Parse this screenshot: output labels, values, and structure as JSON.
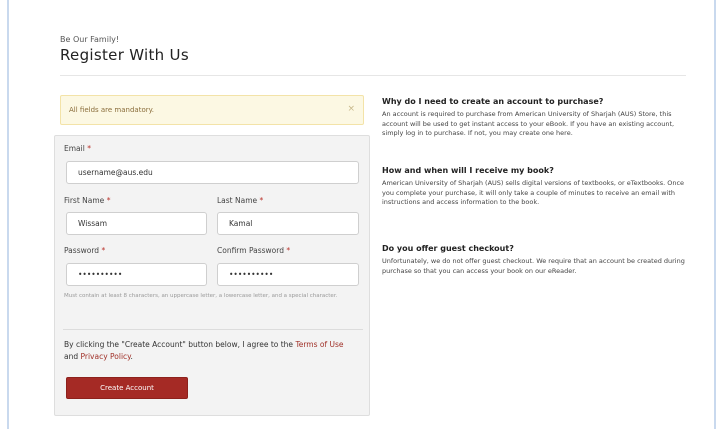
{
  "header": {
    "eyebrow": "Be Our Family!",
    "title": "Register With Us"
  },
  "alert": {
    "text": "All fields are mandatory.",
    "close": "×"
  },
  "form": {
    "email": {
      "label": "Email",
      "required_mark": "*",
      "value": "username@aus.edu"
    },
    "first_name": {
      "label": "First Name",
      "required_mark": "*",
      "value": "Wissam"
    },
    "last_name": {
      "label": "Last Name",
      "required_mark": "*",
      "value": "Kamal"
    },
    "password": {
      "label": "Password",
      "required_mark": "*",
      "value": "••••••••••"
    },
    "confirm_password": {
      "label": "Confirm Password",
      "required_mark": "*",
      "value": "••••••••••"
    },
    "password_hint": "Must contain at least 8 characters, an uppercase letter, a lowercase letter, and a special character.",
    "terms": {
      "prefix": "By clicking the \"Create Account\" button below, I agree to the ",
      "terms_link": "Terms of Use",
      "and": " and ",
      "privacy_link": "Privacy Policy",
      "suffix": "."
    },
    "submit_label": "Create Account"
  },
  "faq": [
    {
      "question": "Why do I need to create an account to purchase?",
      "answer": "An account is required to purchase from American University of Sharjah (AUS) Store, this account will be used to get instant access to your eBook. If you have an existing account, simply log in to purchase. If not, you may create one here."
    },
    {
      "question": "How and when will I receive my book?",
      "answer": "American University of Sharjah (AUS) sells digital versions of textbooks, or eTextbooks. Once you complete your purchase, it will only take a couple of minutes to receive an email with instructions and access information to the book."
    },
    {
      "question": "Do you offer guest checkout?",
      "answer": "Unfortunately, we do not offer guest checkout. We require that an account be created during purchase so that you can access your book on our eReader."
    }
  ],
  "colors": {
    "accent": "#a52a25",
    "alert_bg": "#fcf8e3",
    "panel_bg": "#f3f3f3"
  }
}
